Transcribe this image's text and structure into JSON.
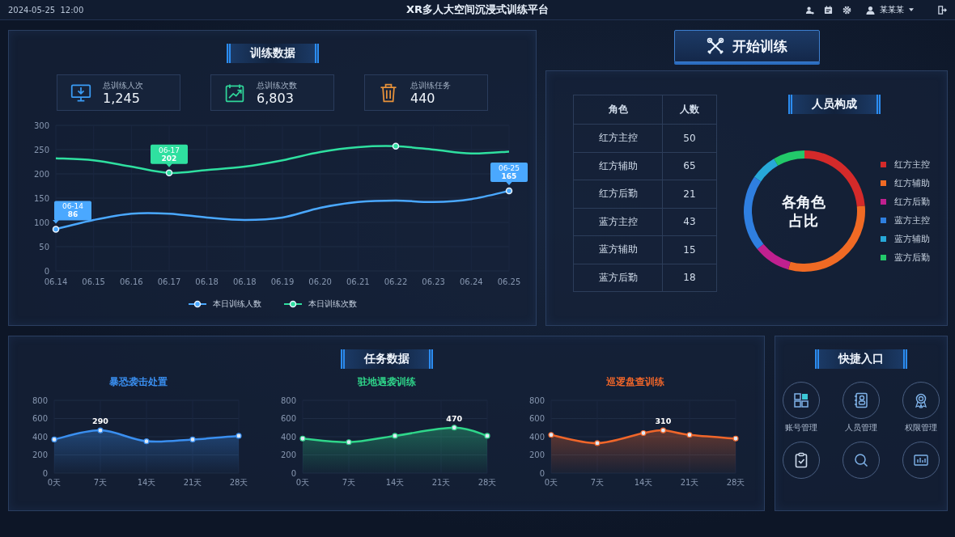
{
  "header": {
    "datetime": "2024-05-25  12:00",
    "title": "XR多人大空间沉浸式训练平台",
    "user": "某某某"
  },
  "training": {
    "title": "训练数据",
    "stats": [
      {
        "label": "总训练人次",
        "value": "1,245",
        "color": "#3a9cf5"
      },
      {
        "label": "总训练次数",
        "value": "6,803",
        "color": "#2fd69a"
      },
      {
        "label": "总训练任务",
        "value": "440",
        "color": "#e8923a"
      }
    ],
    "chart_data": {
      "type": "line",
      "categories": [
        "06.14",
        "06.15",
        "06.16",
        "06.17",
        "06.18",
        "06.18",
        "06.19",
        "06.20",
        "06.21",
        "06.22",
        "06.23",
        "06.24",
        "06.25"
      ],
      "ylim": [
        0,
        300
      ],
      "yticks": [
        0,
        50,
        100,
        150,
        200,
        250,
        300
      ],
      "grid": true,
      "legend": true,
      "series": [
        {
          "name": "本日训练人数",
          "color": "#4aa8ff",
          "values": [
            86,
            105,
            118,
            118,
            110,
            105,
            110,
            130,
            142,
            145,
            142,
            148,
            165
          ]
        },
        {
          "name": "本日训练次数",
          "color": "#2fe0a0",
          "values": [
            232,
            228,
            215,
            202,
            208,
            215,
            228,
            245,
            255,
            257,
            250,
            242,
            246
          ]
        }
      ],
      "annotations": [
        {
          "x": "06.14",
          "y": 86,
          "text": "06-14\n86"
        },
        {
          "x": "06.17",
          "y": 202,
          "text": "06-17\n202"
        },
        {
          "x": "06.25",
          "y": 165,
          "text": "06-25\n165"
        }
      ]
    }
  },
  "start_button": {
    "label": "开始训练"
  },
  "roles": {
    "columns": [
      "角色",
      "人数"
    ],
    "rows": [
      [
        "红方主控",
        "50"
      ],
      [
        "红方辅助",
        "65"
      ],
      [
        "红方后勤",
        "21"
      ],
      [
        "蓝方主控",
        "43"
      ],
      [
        "蓝方辅助",
        "15"
      ],
      [
        "蓝方后勤",
        "18"
      ]
    ]
  },
  "composition": {
    "title": "人员构成",
    "center_label": "各角色占比",
    "chart_data": {
      "type": "donut",
      "categories": [
        "红方主控",
        "红方辅助",
        "红方后勤",
        "蓝方主控",
        "蓝方辅助",
        "蓝方后勤"
      ],
      "values": [
        23.6,
        30.7,
        9.9,
        20.3,
        7.1,
        8.4
      ],
      "colors": [
        "#d42a2a",
        "#f06a24",
        "#c0208f",
        "#2f7fe0",
        "#27a8d8",
        "#22c96a"
      ]
    }
  },
  "tasks": {
    "title": "任务数据",
    "charts": [
      {
        "title": "暴恐袭击处置",
        "color": "#3a8ff0",
        "chart_data": {
          "type": "area",
          "x": [
            0,
            7,
            14,
            21,
            28
          ],
          "values": [
            370,
            470,
            350,
            370,
            410
          ],
          "xlim": [
            0,
            28
          ],
          "ylim": [
            0,
            800
          ],
          "grid": true,
          "yticks": [
            0,
            200,
            400,
            600,
            800
          ],
          "xticks": [
            {
              "value": 0,
              "label": "0天"
            },
            {
              "value": 7,
              "label": "7天"
            },
            {
              "value": 14,
              "label": "14天"
            },
            {
              "value": 21,
              "label": "21天"
            },
            {
              "value": 28,
              "label": "28天"
            }
          ],
          "annotations": [
            {
              "x": 7,
              "y": 470,
              "text": "290"
            }
          ]
        }
      },
      {
        "title": "驻地遇袭训练",
        "color": "#2fd68a",
        "chart_data": {
          "type": "area",
          "x": [
            0,
            7,
            14,
            23,
            28
          ],
          "values": [
            380,
            340,
            410,
            500,
            410
          ],
          "xlim": [
            0,
            28
          ],
          "ylim": [
            0,
            800
          ],
          "grid": true,
          "yticks": [
            0,
            200,
            400,
            600,
            800
          ],
          "xticks": [
            {
              "value": 0,
              "label": "0天"
            },
            {
              "value": 7,
              "label": "7天"
            },
            {
              "value": 14,
              "label": "14天"
            },
            {
              "value": 21,
              "label": "21天"
            },
            {
              "value": 28,
              "label": "28天"
            }
          ],
          "annotations": [
            {
              "x": 23,
              "y": 500,
              "text": "470"
            }
          ]
        }
      },
      {
        "title": "巡逻盘查训练",
        "color": "#f0662a",
        "chart_data": {
          "type": "area",
          "x": [
            0,
            7,
            14,
            17,
            21,
            28
          ],
          "values": [
            420,
            330,
            440,
            470,
            420,
            380
          ],
          "xlim": [
            0,
            28
          ],
          "ylim": [
            0,
            800
          ],
          "grid": true,
          "yticks": [
            0,
            200,
            400,
            600,
            800
          ],
          "xticks": [
            {
              "value": 0,
              "label": "0天"
            },
            {
              "value": 7,
              "label": "7天"
            },
            {
              "value": 14,
              "label": "14天"
            },
            {
              "value": 21,
              "label": "21天"
            },
            {
              "value": 28,
              "label": "28天"
            }
          ],
          "annotations": [
            {
              "x": 17,
              "y": 470,
              "text": "310"
            }
          ]
        }
      }
    ]
  },
  "shortcuts": {
    "title": "快捷入口",
    "items": [
      {
        "kind": "labeled",
        "label": "账号管理"
      },
      {
        "kind": "labeled",
        "label": "人员管理"
      },
      {
        "kind": "labeled",
        "label": "权限管理"
      },
      {
        "kind": "icon-only"
      },
      {
        "kind": "icon-only"
      },
      {
        "kind": "icon-only"
      }
    ]
  }
}
